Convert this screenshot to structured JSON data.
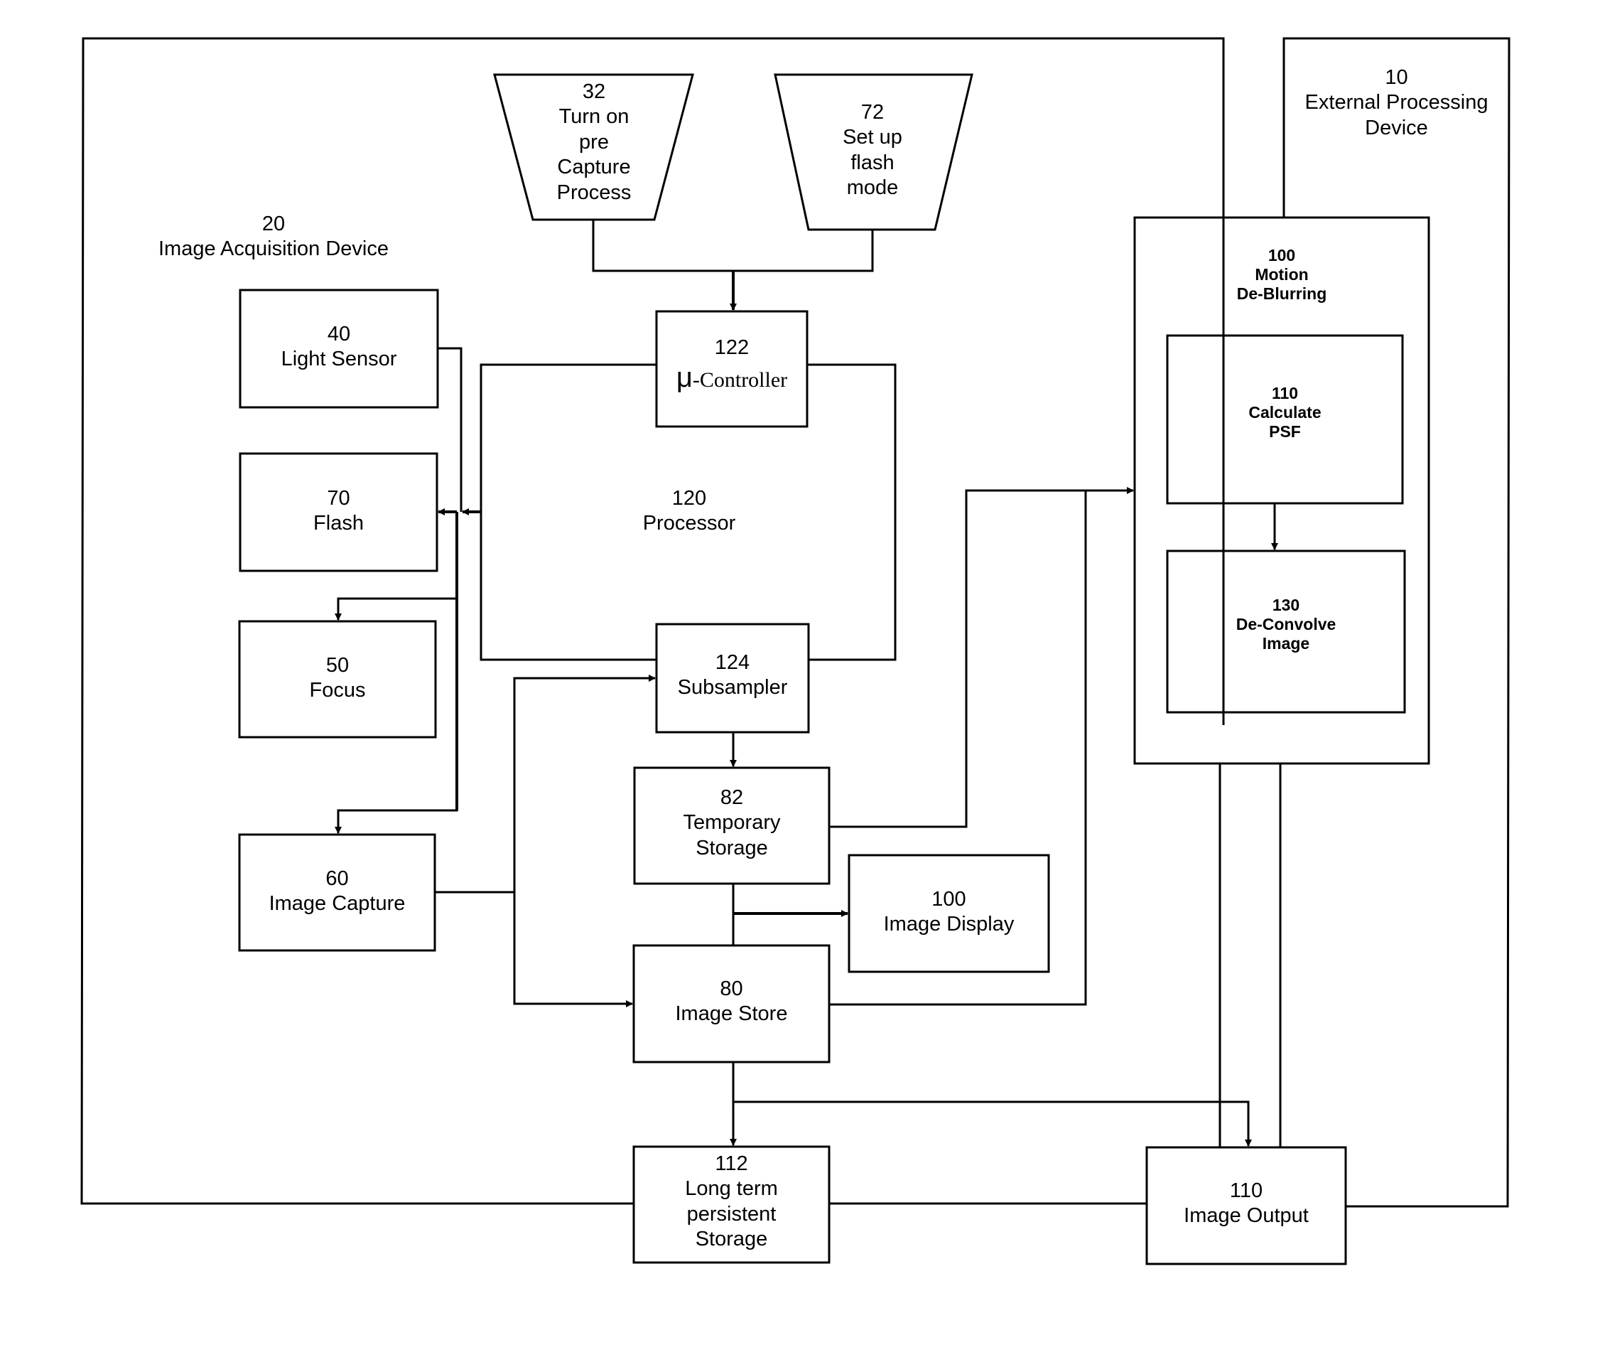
{
  "diagram": {
    "containers": {
      "image_acquisition_device": {
        "number": "20",
        "title": "Image Acquisition Device"
      },
      "external_processing_device": {
        "number": "10",
        "title": "External Processing Device",
        "title_lines": [
          "External Processing",
          "Device"
        ]
      },
      "processor": {
        "number": "120",
        "title": "Processor"
      },
      "motion_deblurring": {
        "number": "100",
        "title_lines": [
          "Motion",
          "De-Blurring"
        ]
      }
    },
    "blocks": {
      "pre_capture": {
        "number": "32",
        "lines": [
          "Turn on",
          "pre",
          "Capture",
          "Process"
        ]
      },
      "flash_mode": {
        "number": "72",
        "lines": [
          "Set up",
          "flash",
          "mode"
        ]
      },
      "micro_controller": {
        "number": "122",
        "prefix": "μ",
        "title": "-Controller"
      },
      "subsampler": {
        "number": "124",
        "title": "Subsampler"
      },
      "light_sensor": {
        "number": "40",
        "title": "Light Sensor"
      },
      "flash": {
        "number": "70",
        "title": "Flash"
      },
      "focus": {
        "number": "50",
        "title": "Focus"
      },
      "image_capture": {
        "number": "60",
        "title": "Image Capture"
      },
      "temporary_storage": {
        "number": "82",
        "lines": [
          "Temporary",
          "Storage"
        ]
      },
      "image_display": {
        "number": "100",
        "title": "Image Display"
      },
      "image_store": {
        "number": "80",
        "title": "Image Store"
      },
      "long_term_storage": {
        "number": "112",
        "lines": [
          "Long term",
          "persistent",
          "Storage"
        ]
      },
      "image_output": {
        "number": "110",
        "title": "Image Output"
      },
      "calculate_psf": {
        "number": "110",
        "lines": [
          "Calculate",
          "PSF"
        ]
      },
      "deconvolve_image": {
        "number": "130",
        "lines": [
          "De-Convolve",
          "Image"
        ]
      }
    },
    "connections": [
      {
        "from": "pre_capture",
        "to": "micro_controller",
        "arrow": true
      },
      {
        "from": "flash_mode",
        "to": "micro_controller",
        "arrow": true
      },
      {
        "from": "light_sensor",
        "to": "processor",
        "arrow": false
      },
      {
        "from": "processor",
        "to": "flash",
        "arrow": "bidirectional"
      },
      {
        "from": "processor",
        "to": "focus",
        "arrow": true
      },
      {
        "from": "processor",
        "to": "image_capture",
        "arrow": true
      },
      {
        "from": "image_capture",
        "to": "subsampler",
        "arrow": true
      },
      {
        "from": "image_capture",
        "to": "image_store",
        "arrow": true
      },
      {
        "from": "subsampler",
        "to": "temporary_storage",
        "arrow": true
      },
      {
        "from": "temporary_storage",
        "to": "image_display",
        "arrow": true
      },
      {
        "from": "temporary_storage",
        "to": "motion_deblurring",
        "arrow": true
      },
      {
        "from": "image_store",
        "to": "motion_deblurring",
        "arrow": true
      },
      {
        "from": "calculate_psf",
        "to": "deconvolve_image",
        "arrow": true
      },
      {
        "from": "image_store",
        "to": "long_term_storage",
        "arrow": true
      },
      {
        "from": "image_store",
        "to": "image_output",
        "arrow": true
      },
      {
        "from": "motion_deblurring",
        "to": "image_output",
        "arrow": false
      }
    ],
    "line_color": "#000000",
    "background": "#ffffff"
  }
}
